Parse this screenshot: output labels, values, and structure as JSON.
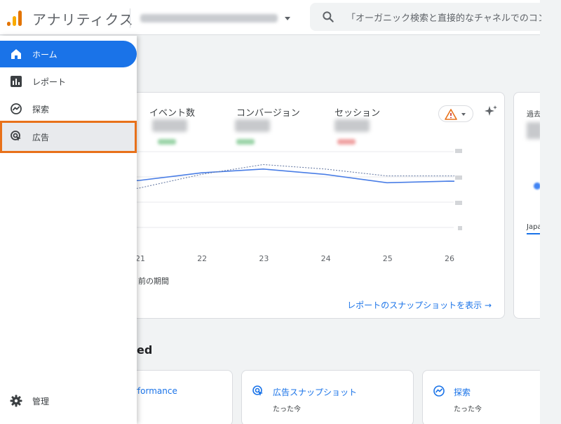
{
  "header": {
    "app_title": "アナリティクス",
    "search_placeholder": "「オーガニック検索と直接的なチャネルでのコン"
  },
  "sidebar": {
    "items": [
      {
        "label": "ホーム",
        "icon": "home-icon"
      },
      {
        "label": "レポート",
        "icon": "reports-icon"
      },
      {
        "label": "探索",
        "icon": "explore-icon"
      },
      {
        "label": "広告",
        "icon": "advertising-icon"
      }
    ],
    "admin_label": "管理"
  },
  "metrics": {
    "event_count": "イベント数",
    "conversions": "コンバージョン",
    "sessions": "セッション"
  },
  "chart_data": {
    "type": "line",
    "x": [
      "21",
      "22",
      "23",
      "24",
      "25",
      "26"
    ],
    "series": [
      {
        "values": [
          0.62,
          0.72,
          0.77,
          0.7,
          0.59,
          0.61
        ]
      },
      {
        "values": [
          0.52,
          0.7,
          0.83,
          0.77,
          0.68,
          0.68
        ]
      }
    ],
    "legend": [
      "前の期間"
    ],
    "colors": {
      "current": "#4a7ee6",
      "previous": "#6b7ea6"
    }
  },
  "snapshot_link": "レポートのスナップショットを表示 →",
  "side_card": {
    "title": "過去",
    "label": "Japa"
  },
  "recent": {
    "section_title": "ed",
    "tiles": [
      {
        "title": "rformance",
        "sub": ""
      },
      {
        "title": "広告スナップショット",
        "sub": "たった今"
      },
      {
        "title": "探索",
        "sub": "たった今"
      }
    ]
  },
  "colors": {
    "accent": "#1a73e8",
    "highlight": "#e8711a"
  }
}
